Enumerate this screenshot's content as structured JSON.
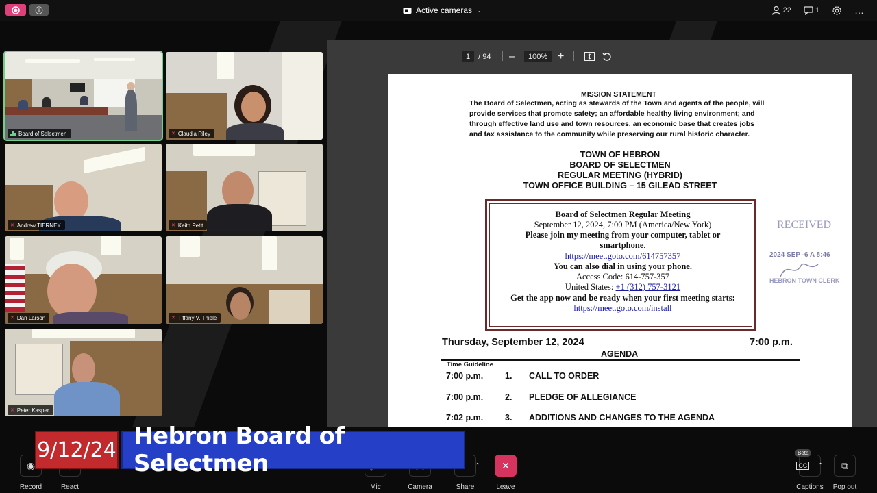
{
  "topbar": {
    "camera_menu_label": "Active cameras",
    "participants_count": "22",
    "chat_count": "1"
  },
  "participants": [
    {
      "name": "Board of Selectmen",
      "muted": false
    },
    {
      "name": "Claudia Riley",
      "muted": true
    },
    {
      "name": "Andrew TIERNEY",
      "muted": true
    },
    {
      "name": "Keith Petit",
      "muted": true
    },
    {
      "name": "Dan Larson",
      "muted": true
    },
    {
      "name": "Tiffany V. Thiele",
      "muted": true
    },
    {
      "name": "Peter Kasper",
      "muted": true
    }
  ],
  "pdf_toolbar": {
    "page_current": "1",
    "page_total": "/ 94",
    "zoom": "100%"
  },
  "document": {
    "mission_heading": "MISSION STATEMENT",
    "mission_lines": [
      "The Board of Selectmen, acting as stewards of the Town and agents of the people, will",
      "provide services that promote safety; an affordable healthy living environment; and",
      "through effective land use and town resources, an economic base that creates jobs",
      "and tax assistance to the community while preserving our rural historic character."
    ],
    "header_lines": [
      "TOWN OF HEBRON",
      "BOARD OF SELECTMEN",
      "REGULAR MEETING (HYBRID)",
      "TOWN OFFICE BUILDING – 15 GILEAD STREET"
    ],
    "goto_box": {
      "title": "Board of Selectmen Regular Meeting",
      "datetime": "September 12, 2024, 7:00 PM (America/New York)",
      "join_line1": "Please join my meeting from your computer, tablet or",
      "join_line2": "smartphone.",
      "meeting_link": "https://meet.goto.com/614757357",
      "dial_line": "You can also dial in using your phone.",
      "access_code": "Access Code: 614-757-357",
      "us_label": "United States: ",
      "us_phone": "+1 (312) 757-3121",
      "app_line": "Get the app now and be ready when your first meeting starts:",
      "install_link": "https://meet.goto.com/install"
    },
    "stamp": {
      "received": "RECEIVED",
      "date": "2024 SEP -6 A 8:46",
      "clerk": "HEBRON TOWN CLERK"
    },
    "meeting_date": "Thursday, September 12, 2024",
    "meeting_time": "7:00 p.m.",
    "agenda_heading": "AGENDA",
    "time_guideline_label": "Time Guideline",
    "agenda_items": [
      {
        "time": "7:00 p.m.",
        "num": "1.",
        "title": "CALL TO ORDER"
      },
      {
        "time": "7:00 p.m.",
        "num": "2.",
        "title": "PLEDGE OF ALLEGIANCE"
      },
      {
        "time": "7:02 p.m.",
        "num": "3.",
        "title": "ADDITIONS AND CHANGES TO THE AGENDA"
      }
    ]
  },
  "controls": {
    "record": "Record",
    "react": "React",
    "mic": "Mic",
    "camera": "Camera",
    "share": "Share",
    "leave": "Leave",
    "captions": "Captions",
    "captions_badge": "Beta",
    "popout": "Pop out"
  },
  "banner": {
    "date": "9/12/24",
    "title": "Hebron Board of Selectmen"
  },
  "colors": {
    "active_speaker": "#6fd08c",
    "leave": "#d7335f",
    "banner_date_bg": "#c22a2e",
    "banner_title_bg": "#2540c6"
  }
}
